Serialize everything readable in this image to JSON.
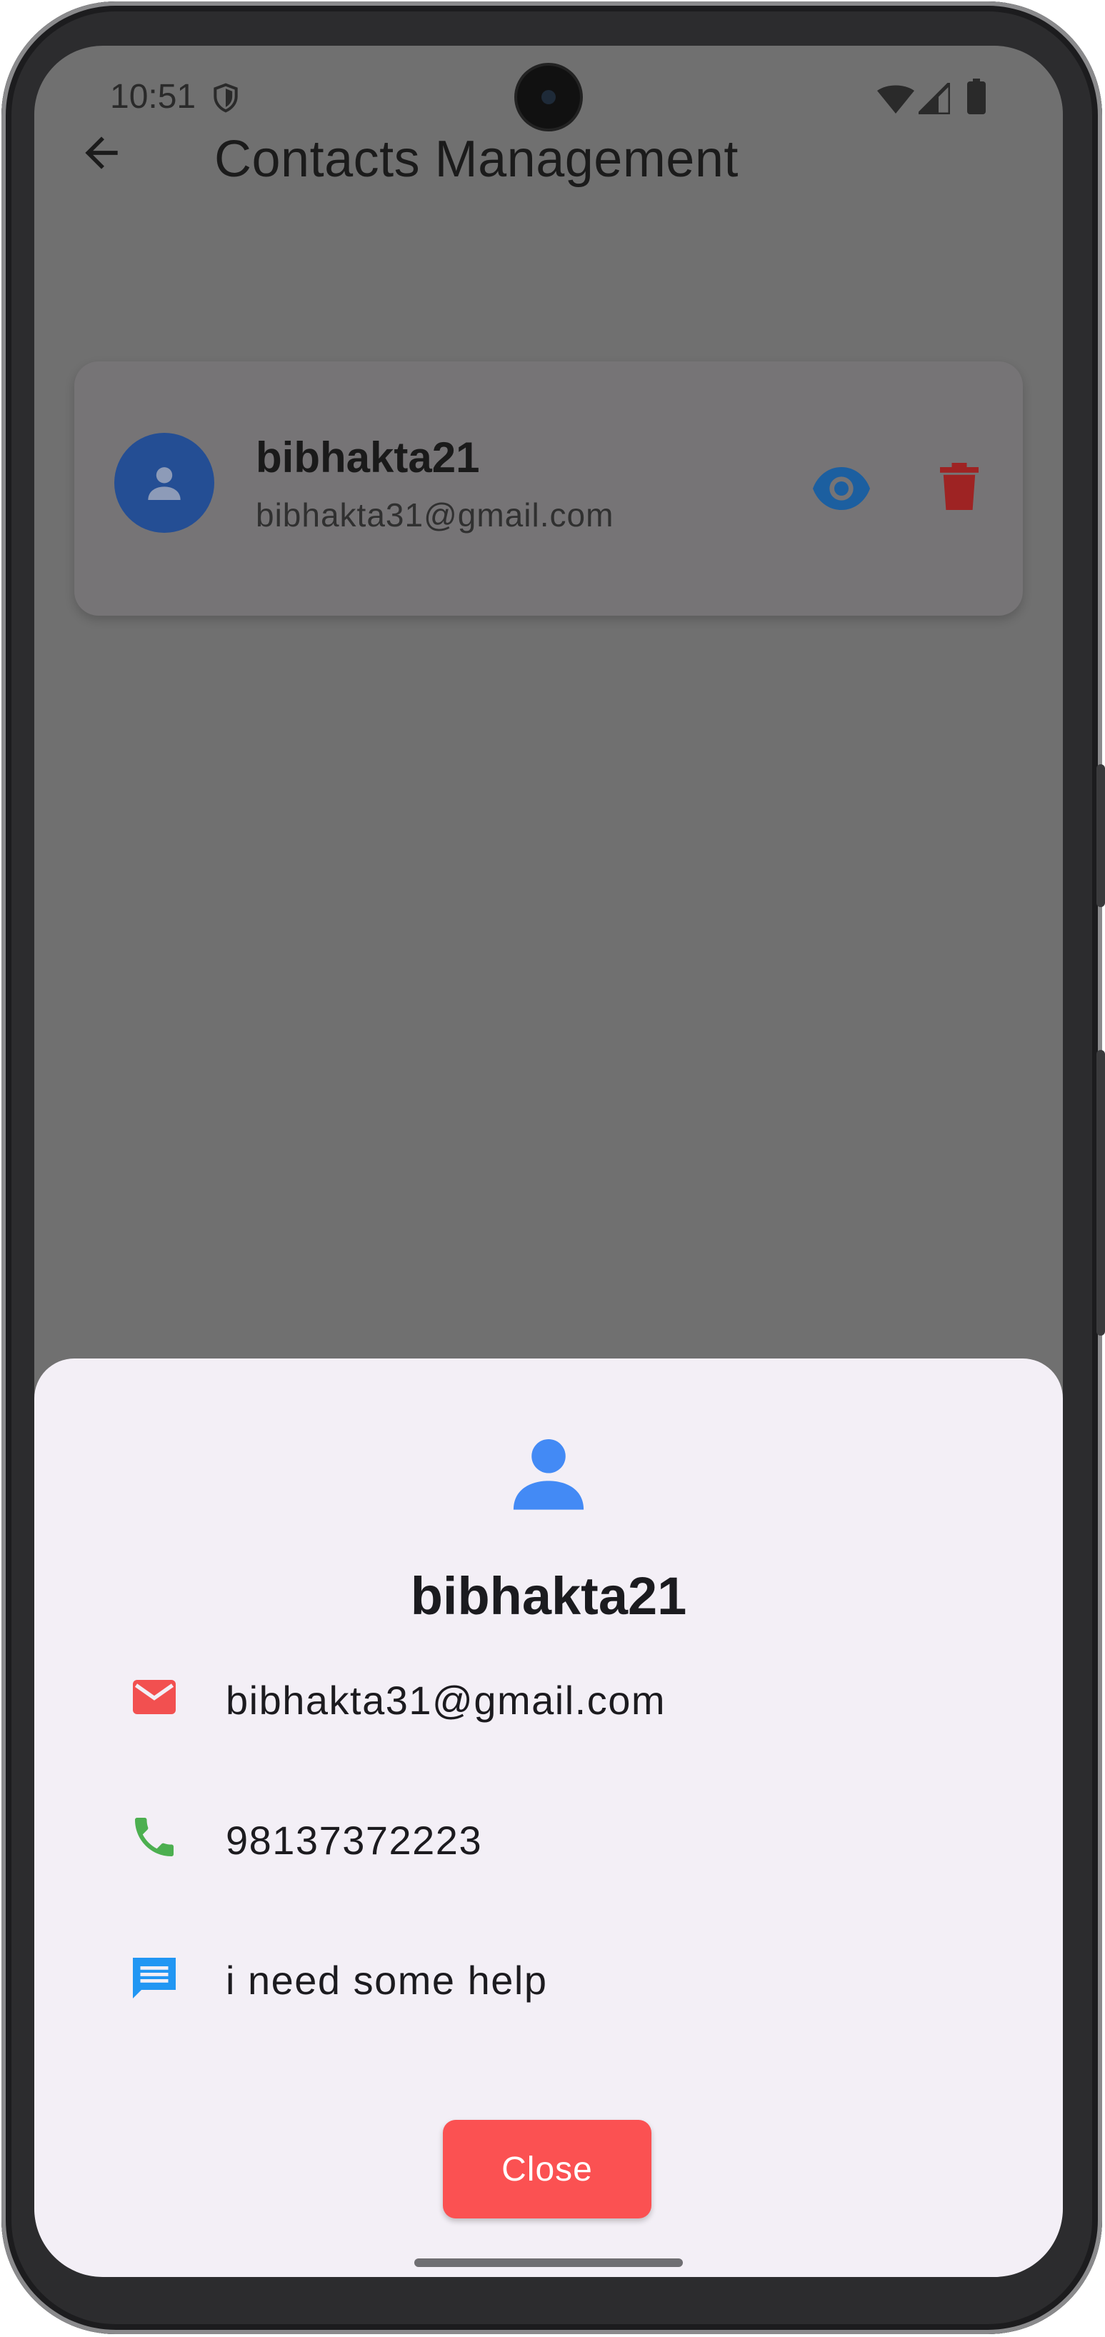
{
  "status_bar": {
    "time": "10:51"
  },
  "app_bar": {
    "title": "Contacts Management"
  },
  "contact_card": {
    "name": "bibhakta21",
    "email": "bibhakta31@gmail.com"
  },
  "sheet": {
    "name": "bibhakta21",
    "email": "bibhakta31@gmail.com",
    "phone": "98137372223",
    "message": "i need some help",
    "close_label": "Close"
  },
  "colors": {
    "scrim": "#707070",
    "avatar_bg": "#244e94",
    "view_icon": "#1c5fa0",
    "delete_icon": "#9e2323",
    "sheet_bg": "#f3eff6",
    "person_icon": "#438af5",
    "email_icon": "#f25050",
    "phone_icon": "#4caf50",
    "message_icon": "#2196f3",
    "close_button": "#fb5152"
  },
  "icons": [
    "shield-icon",
    "wifi-icon",
    "signal-icon",
    "battery-icon",
    "back-arrow-icon",
    "person-icon",
    "eye-icon",
    "trash-icon",
    "email-icon",
    "phone-icon",
    "message-icon"
  ]
}
